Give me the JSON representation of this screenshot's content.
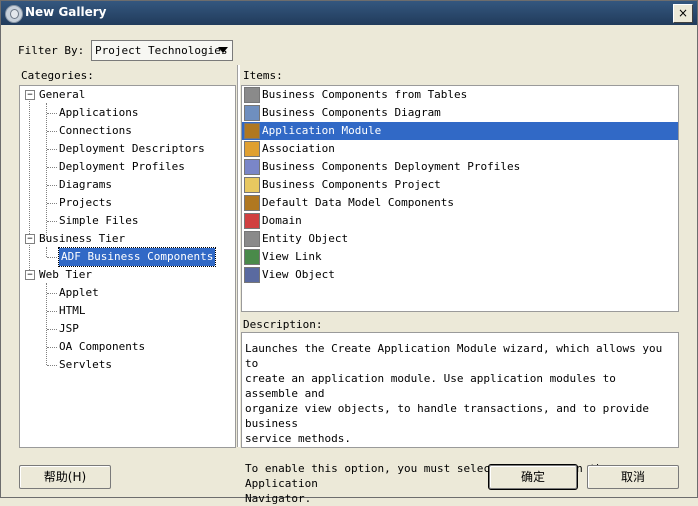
{
  "window": {
    "title": "New Gallery",
    "close_glyph": "×"
  },
  "filter": {
    "label": "Filter By:",
    "accelerator": "F",
    "value": "Project Technologies"
  },
  "categories": {
    "label": "Categories:",
    "nodes": [
      {
        "label": "General",
        "expander": "−"
      },
      {
        "label": "Applications"
      },
      {
        "label": "Connections"
      },
      {
        "label": "Deployment Descriptors"
      },
      {
        "label": "Deployment Profiles"
      },
      {
        "label": "Diagrams"
      },
      {
        "label": "Projects"
      },
      {
        "label": "Simple Files"
      },
      {
        "label": "Business Tier",
        "expander": "−"
      },
      {
        "label": "ADF Business Components"
      },
      {
        "label": "Web Tier",
        "expander": "−"
      },
      {
        "label": "Applet"
      },
      {
        "label": "HTML"
      },
      {
        "label": "JSP"
      },
      {
        "label": "OA Components"
      },
      {
        "label": "Servlets"
      }
    ]
  },
  "items": {
    "label": "Items:",
    "list": [
      {
        "label": "Business Components from Tables",
        "icon": "gear-table-icon",
        "color": "#8a8a8a"
      },
      {
        "label": "Business Components Diagram",
        "icon": "diagram-icon",
        "color": "#6f8fbf"
      },
      {
        "label": "Application Module",
        "icon": "app-module-icon",
        "color": "#b07820"
      },
      {
        "label": "Association",
        "icon": "association-icon",
        "color": "#e0a030"
      },
      {
        "label": "Business Components Deployment Profiles",
        "icon": "deployment-profile-icon",
        "color": "#7a86c8"
      },
      {
        "label": "Business Components Project",
        "icon": "project-icon",
        "color": "#e8c860"
      },
      {
        "label": "Default Data Model Components",
        "icon": "data-model-icon",
        "color": "#b07820"
      },
      {
        "label": "Domain",
        "icon": "domain-icon",
        "color": "#d04040"
      },
      {
        "label": "Entity Object",
        "icon": "entity-object-icon",
        "color": "#8a8a8a"
      },
      {
        "label": "View Link",
        "icon": "view-link-icon",
        "color": "#4a8a4a"
      },
      {
        "label": "View Object",
        "icon": "view-object-icon",
        "color": "#5a6aa0"
      }
    ]
  },
  "description": {
    "label": "Description:",
    "text": "Launches the Create Application Module wizard, which allows you to\ncreate an application module. Use application modules to assemble and\norganize view objects, to handle transactions, and to provide business\nservice methods.\n\nTo enable this option, you must select a project in the Application\nNavigator."
  },
  "buttons": {
    "help": "帮助(H)",
    "ok": "确定",
    "cancel": "取消"
  },
  "colors": {
    "selection": "#3169c6",
    "titlebar": "#2a4a70",
    "dialog_bg": "#ece9d8"
  }
}
